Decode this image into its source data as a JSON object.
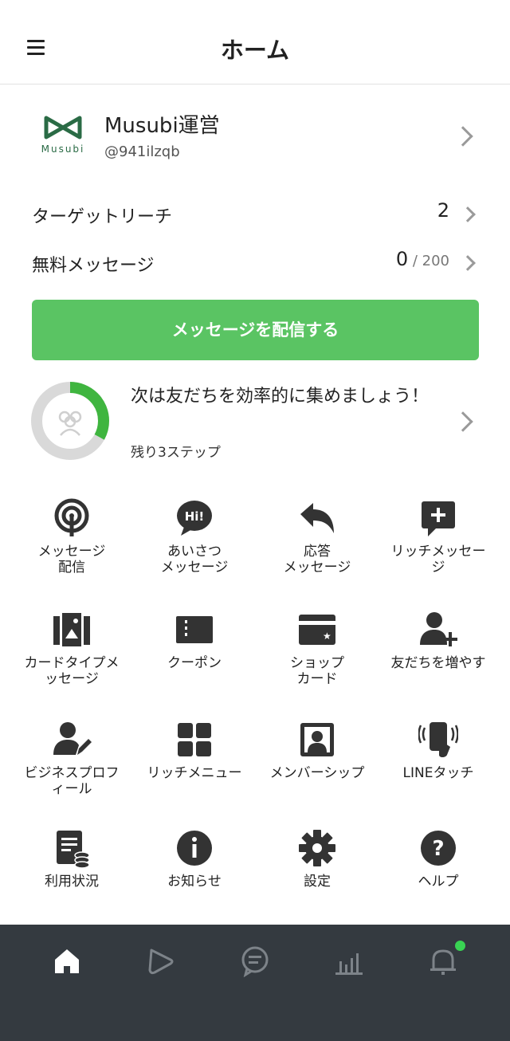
{
  "header": {
    "title": "ホーム"
  },
  "account": {
    "name": "Musubi運営",
    "id": "@941ilzqb",
    "logo_text": "Musubi",
    "logo_color": "#2a6b45"
  },
  "stats": [
    {
      "label": "ターゲットリーチ",
      "value": "2",
      "sub": ""
    },
    {
      "label": "無料メッセージ",
      "value": "0",
      "sub": " / 200"
    }
  ],
  "cta": {
    "label": "メッセージを配信する",
    "color": "#5ac463"
  },
  "progress": {
    "title": "次は友だちを効率的に集めましょう！",
    "subtitle": "残り3ステップ",
    "fraction": 0.33,
    "color": "#3fb53f"
  },
  "features": [
    {
      "icon": "broadcast-icon",
      "label": "メッセージ\n配信"
    },
    {
      "icon": "hi-bubble-icon",
      "label": "あいさつ\nメッセージ"
    },
    {
      "icon": "reply-arrow-icon",
      "label": "応答\nメッセージ"
    },
    {
      "icon": "rich-message-icon",
      "label": "リッチメッセー\nジ"
    },
    {
      "icon": "card-message-icon",
      "label": "カードタイプメ\nッセージ"
    },
    {
      "icon": "coupon-icon",
      "label": "クーポン"
    },
    {
      "icon": "shop-card-icon",
      "label": "ショップ\nカード"
    },
    {
      "icon": "add-friend-icon",
      "label": "友だちを増やす"
    },
    {
      "icon": "business-profile-icon",
      "label": "ビジネスプロフ\nィール"
    },
    {
      "icon": "rich-menu-icon",
      "label": "リッチメニュー"
    },
    {
      "icon": "membership-icon",
      "label": "メンバーシップ"
    },
    {
      "icon": "line-touch-icon",
      "label": "LINEタッチ"
    },
    {
      "icon": "usage-icon",
      "label": "利用状況"
    },
    {
      "icon": "info-icon",
      "label": "お知らせ"
    },
    {
      "icon": "gear-icon",
      "label": "設定"
    },
    {
      "icon": "help-icon",
      "label": "ヘルプ"
    }
  ],
  "bottom_nav": [
    {
      "icon": "home-icon",
      "active": true
    },
    {
      "icon": "voom-icon",
      "active": false
    },
    {
      "icon": "chat-icon",
      "active": false
    },
    {
      "icon": "analytics-icon",
      "active": false
    },
    {
      "icon": "bell-icon",
      "active": false,
      "badge": true
    }
  ]
}
